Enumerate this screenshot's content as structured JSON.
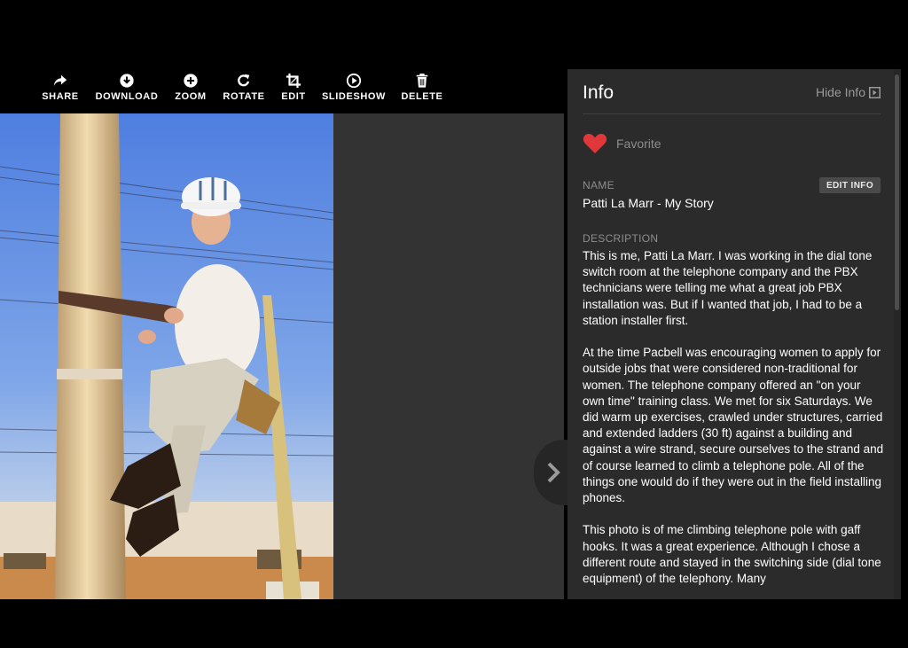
{
  "toolbar": {
    "items": [
      {
        "label": "SHARE",
        "icon": "share-icon"
      },
      {
        "label": "DOWNLOAD",
        "icon": "download-icon"
      },
      {
        "label": "ZOOM",
        "icon": "zoom-in-icon"
      },
      {
        "label": "ROTATE",
        "icon": "rotate-icon"
      },
      {
        "label": "EDIT",
        "icon": "crop-icon"
      },
      {
        "label": "SLIDESHOW",
        "icon": "play-icon"
      },
      {
        "label": "DELETE",
        "icon": "trash-icon"
      }
    ]
  },
  "viewer": {
    "next_icon": "chevron-right-icon"
  },
  "info_panel": {
    "title": "Info",
    "hide_label": "Hide Info",
    "favorite_label": "Favorite",
    "favorite_color": "#e0373b",
    "name_label": "NAME",
    "edit_info_label": "EDIT INFO",
    "name_value": "Patti La Marr - My Story",
    "description_label": "DESCRIPTION",
    "description": "This is me, Patti La Marr.  I was working in the dial tone switch room at the telephone company and the PBX technicians were telling me what a great job PBX installation was.  But if I wanted that job, I had to be a station installer first.\n\nAt the time Pacbell was encouraging women to apply for outside jobs that were considered non-traditional for women. The telephone company offered an \"on your own time\" training class.  We met for six Saturdays.  We did warm up exercises, crawled under structures, carried and extended ladders (30 ft) against a building and against a wire strand, secure ourselves to the strand and of course learned to climb a telephone pole.  All of the things one would do if they were out in the field installing phones.\n\nThis photo is of me climbing telephone pole with gaff hooks.  It was a great experience.  Although I chose a different route and stayed in the switching side (dial tone equipment) of the telephony.  Many"
  }
}
